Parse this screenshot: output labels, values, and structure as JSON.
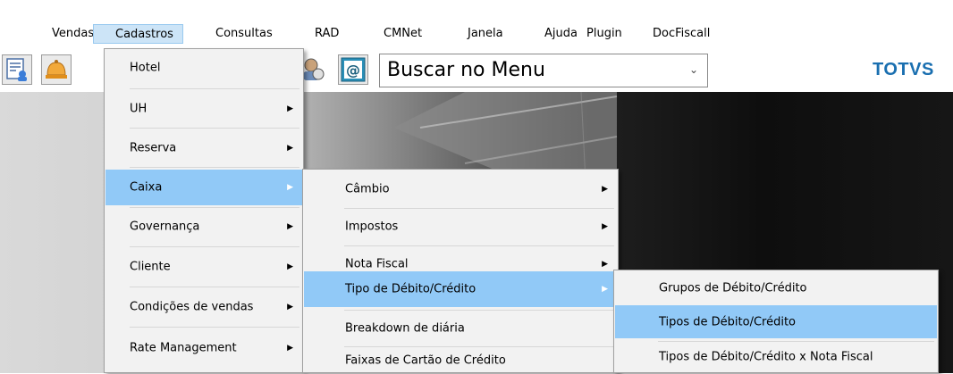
{
  "menubar": {
    "items": [
      "Vendas",
      "Cadastros",
      "Consultas",
      "RAD",
      "CMNet",
      "Janela",
      "Ajuda",
      "Plugin",
      "DocFiscall"
    ]
  },
  "toolbar": {
    "search_value": "Buscar no Menu",
    "search_icon_name": "chevron-down-icon",
    "brand": "TOTVS",
    "icons": [
      "guest-card-icon",
      "bell-icon",
      "user-info-icon",
      "email-at-icon"
    ]
  },
  "menus": {
    "cadastros": [
      "Hotel",
      "UH",
      "Reserva",
      "Caixa",
      "Governança",
      "Cliente",
      "Condições de vendas",
      "Rate Management"
    ],
    "caixa": [
      "Câmbio",
      "Impostos",
      "Nota Fiscal",
      "Tipo de Débito/Crédito",
      "Breakdown de diária",
      "Faixas de Cartão de Crédito"
    ],
    "tipo_debito": [
      "Grupos de Débito/Crédito",
      "Tipos de Débito/Crédito",
      "Tipos de Débito/Crédito x Nota Fiscal"
    ]
  },
  "colors": {
    "highlight": "#91c9f7",
    "menubar_active": "#cce4f7",
    "brand": "#1a6fb0"
  }
}
